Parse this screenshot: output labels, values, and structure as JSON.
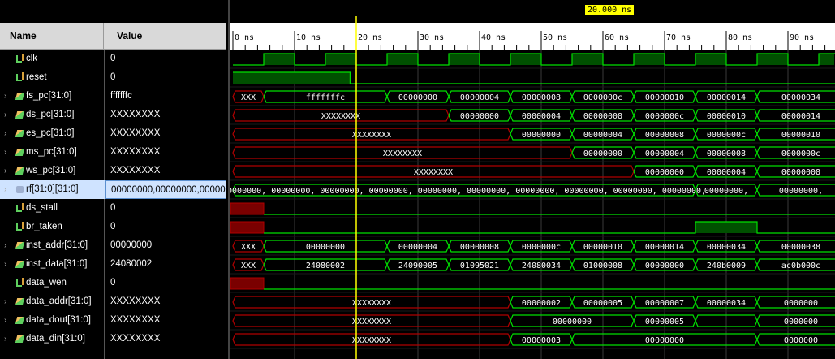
{
  "cursor": {
    "label": "20.000 ns",
    "time": 20
  },
  "columns": {
    "name": "Name",
    "value": "Value"
  },
  "time_axis": {
    "start": 0,
    "end": 97.5,
    "ticks": [
      {
        "t": 0,
        "label": "0 ns"
      },
      {
        "t": 10,
        "label": "10 ns"
      },
      {
        "t": 20,
        "label": "20 ns"
      },
      {
        "t": 30,
        "label": "30 ns"
      },
      {
        "t": 40,
        "label": "40 ns"
      },
      {
        "t": 50,
        "label": "50 ns"
      },
      {
        "t": 60,
        "label": "60 ns"
      },
      {
        "t": 70,
        "label": "70 ns"
      },
      {
        "t": 80,
        "label": "80 ns"
      },
      {
        "t": 90,
        "label": "90 ns"
      }
    ]
  },
  "colors": {
    "valid": "#00e000",
    "invalid": "#b00000",
    "text": "#ffffff",
    "cursor": "#ffff00",
    "grid": "#3a3a3a"
  },
  "signals": [
    {
      "name": "clk",
      "value": "0",
      "kind": "bit",
      "expandable": false,
      "edges": [
        [
          0,
          0
        ],
        [
          5,
          1
        ],
        [
          10,
          0
        ],
        [
          15,
          1
        ],
        [
          20,
          0
        ],
        [
          25,
          1
        ],
        [
          30,
          0
        ],
        [
          35,
          1
        ],
        [
          40,
          0
        ],
        [
          45,
          1
        ],
        [
          50,
          0
        ],
        [
          55,
          1
        ],
        [
          60,
          0
        ],
        [
          65,
          1
        ],
        [
          70,
          0
        ],
        [
          75,
          1
        ],
        [
          80,
          0
        ],
        [
          85,
          1
        ],
        [
          90,
          0
        ],
        [
          95,
          1
        ]
      ]
    },
    {
      "name": "reset",
      "value": "0",
      "kind": "bit",
      "expandable": false,
      "edges": [
        [
          0,
          1
        ],
        [
          19,
          0
        ]
      ]
    },
    {
      "name": "fs_pc[31:0]",
      "value": "fffffffc",
      "kind": "bus",
      "expandable": true,
      "segs": [
        [
          0,
          "XXX",
          1
        ],
        [
          5,
          "fffffffc",
          0
        ],
        [
          25,
          "00000000",
          0
        ],
        [
          35,
          "00000004",
          0
        ],
        [
          45,
          "00000008",
          0
        ],
        [
          55,
          "0000000c",
          0
        ],
        [
          65,
          "00000010",
          0
        ],
        [
          75,
          "00000014",
          0
        ],
        [
          85,
          "00000034",
          0
        ]
      ]
    },
    {
      "name": "ds_pc[31:0]",
      "value": "XXXXXXXX",
      "kind": "bus",
      "expandable": true,
      "segs": [
        [
          0,
          "XXXXXXXX",
          1
        ],
        [
          35,
          "00000000",
          0
        ],
        [
          45,
          "00000004",
          0
        ],
        [
          55,
          "00000008",
          0
        ],
        [
          65,
          "0000000c",
          0
        ],
        [
          75,
          "00000010",
          0
        ],
        [
          85,
          "00000014",
          0
        ]
      ]
    },
    {
      "name": "es_pc[31:0]",
      "value": "XXXXXXXX",
      "kind": "bus",
      "expandable": true,
      "segs": [
        [
          0,
          "XXXXXXXX",
          1
        ],
        [
          45,
          "00000000",
          0
        ],
        [
          55,
          "00000004",
          0
        ],
        [
          65,
          "00000008",
          0
        ],
        [
          75,
          "0000000c",
          0
        ],
        [
          85,
          "00000010",
          0
        ]
      ]
    },
    {
      "name": "ms_pc[31:0]",
      "value": "XXXXXXXX",
      "kind": "bus",
      "expandable": true,
      "segs": [
        [
          0,
          "XXXXXXXX",
          1
        ],
        [
          55,
          "00000000",
          0
        ],
        [
          65,
          "00000004",
          0
        ],
        [
          75,
          "00000008",
          0
        ],
        [
          85,
          "0000000c",
          0
        ]
      ]
    },
    {
      "name": "ws_pc[31:0]",
      "value": "XXXXXXXX",
      "kind": "bus",
      "expandable": true,
      "segs": [
        [
          0,
          "XXXXXXXX",
          1
        ],
        [
          65,
          "00000000",
          0
        ],
        [
          75,
          "00000004",
          0
        ],
        [
          85,
          "00000008",
          0
        ]
      ]
    },
    {
      "name": "rf[31:0][31:0]",
      "value": "00000000,00000000,000000",
      "kind": "arr",
      "expandable": true,
      "selected": true,
      "segs": [
        [
          0,
          "00000000, 00000000, 00000000, 00000000, 00000000, 00000000, 00000000, 00000000, 00000000, 00000000,",
          0
        ],
        [
          75,
          "00000000,",
          0
        ],
        [
          85,
          "00000000,",
          0
        ]
      ]
    },
    {
      "name": "ds_stall",
      "value": "0",
      "kind": "bit",
      "expandable": false,
      "xuntil": 5,
      "edges": [
        [
          5,
          0
        ]
      ]
    },
    {
      "name": "br_taken",
      "value": "0",
      "kind": "bit",
      "expandable": false,
      "xuntil": 5,
      "edges": [
        [
          5,
          0
        ],
        [
          75,
          1
        ],
        [
          85,
          0
        ]
      ]
    },
    {
      "name": "inst_addr[31:0]",
      "value": "00000000",
      "kind": "bus",
      "expandable": true,
      "segs": [
        [
          0,
          "XXX",
          1
        ],
        [
          5,
          "00000000",
          0
        ],
        [
          25,
          "00000004",
          0
        ],
        [
          35,
          "00000008",
          0
        ],
        [
          45,
          "0000000c",
          0
        ],
        [
          55,
          "00000010",
          0
        ],
        [
          65,
          "00000014",
          0
        ],
        [
          75,
          "00000034",
          0
        ],
        [
          85,
          "00000038",
          0
        ]
      ]
    },
    {
      "name": "inst_data[31:0]",
      "value": "24080002",
      "kind": "bus",
      "expandable": true,
      "segs": [
        [
          0,
          "XXX",
          1
        ],
        [
          5,
          "24080002",
          0
        ],
        [
          25,
          "24090005",
          0
        ],
        [
          35,
          "01095021",
          0
        ],
        [
          45,
          "24080034",
          0
        ],
        [
          55,
          "01000008",
          0
        ],
        [
          65,
          "00000000",
          0
        ],
        [
          75,
          "240b0009",
          0
        ],
        [
          85,
          "ac0b000c",
          0
        ]
      ]
    },
    {
      "name": "data_wen",
      "value": "0",
      "kind": "bit",
      "expandable": false,
      "xuntil": 5,
      "edges": [
        [
          5,
          0
        ]
      ]
    },
    {
      "name": "data_addr[31:0]",
      "value": "XXXXXXXX",
      "kind": "bus",
      "expandable": true,
      "segs": [
        [
          0,
          "XXXXXXXX",
          1
        ],
        [
          45,
          "00000002",
          0
        ],
        [
          55,
          "00000005",
          0
        ],
        [
          65,
          "00000007",
          0
        ],
        [
          75,
          "00000034",
          0
        ],
        [
          85,
          "0000000",
          0
        ]
      ]
    },
    {
      "name": "data_dout[31:0]",
      "value": "XXXXXXXX",
      "kind": "bus",
      "expandable": true,
      "segs": [
        [
          0,
          "XXXXXXXX",
          1
        ],
        [
          45,
          "00000000",
          0
        ],
        [
          65,
          "00000005",
          0
        ],
        [
          75,
          "",
          0
        ],
        [
          85,
          "0000000",
          0
        ]
      ]
    },
    {
      "name": "data_din[31:0]",
      "value": "XXXXXXXX",
      "kind": "bus",
      "expandable": true,
      "segs": [
        [
          0,
          "XXXXXXXX",
          1
        ],
        [
          45,
          "00000003",
          0
        ],
        [
          55,
          "00000000",
          0
        ],
        [
          85,
          "0000000",
          0
        ]
      ]
    }
  ]
}
